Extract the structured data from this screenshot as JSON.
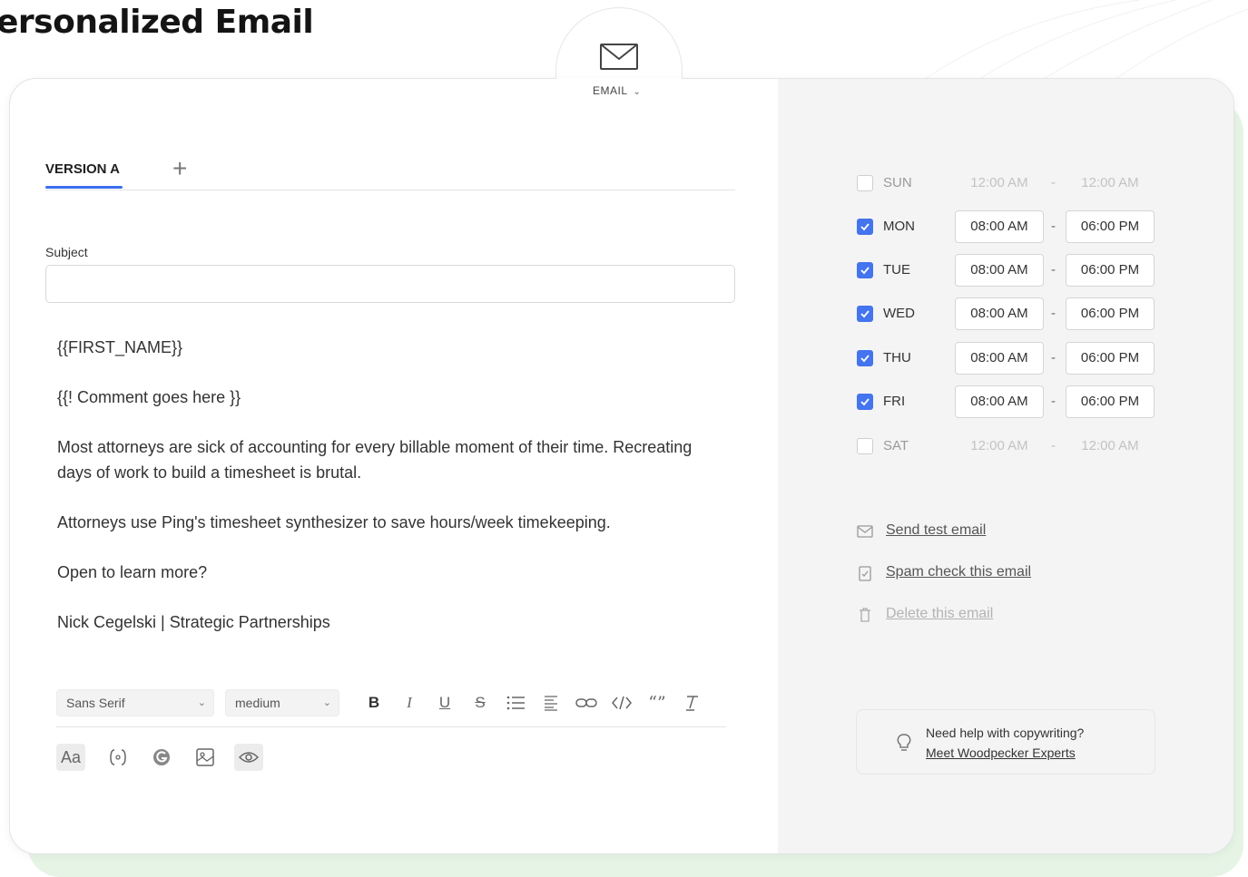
{
  "page": {
    "title": "ersonalized Email"
  },
  "channel": {
    "label": "EMAIL",
    "icon": "envelope-icon"
  },
  "tabs": [
    {
      "label": "VERSION A",
      "active": true
    }
  ],
  "subject": {
    "label": "Subject",
    "value": ""
  },
  "body_lines": [
    "{{FIRST_NAME}}",
    "{{! Comment goes here }}",
    "Most attorneys are sick of accounting for every billable moment of their time. Recreating",
    "days of work to build a timesheet is brutal.",
    "Attorneys use Ping's timesheet synthesizer to save hours/week timekeeping.",
    "Open to learn more?",
    "Nick Cegelski | Strategic Partnerships"
  ],
  "toolbar": {
    "font_family": "Sans Serif",
    "font_size": "medium",
    "bold": "B",
    "italic": "I",
    "underline": "U",
    "strike": "S",
    "font_case": "Aa"
  },
  "schedule": [
    {
      "day": "SUN",
      "enabled": false,
      "from": "12:00 AM",
      "to": "12:00 AM"
    },
    {
      "day": "MON",
      "enabled": true,
      "from": "08:00 AM",
      "to": "06:00 PM"
    },
    {
      "day": "TUE",
      "enabled": true,
      "from": "08:00 AM",
      "to": "06:00 PM"
    },
    {
      "day": "WED",
      "enabled": true,
      "from": "08:00 AM",
      "to": "06:00 PM"
    },
    {
      "day": "THU",
      "enabled": true,
      "from": "08:00 AM",
      "to": "06:00 PM"
    },
    {
      "day": "FRI",
      "enabled": true,
      "from": "08:00 AM",
      "to": "06:00 PM"
    },
    {
      "day": "SAT",
      "enabled": false,
      "from": "12:00 AM",
      "to": "12:00 AM"
    }
  ],
  "schedule_separator": "-",
  "actions": {
    "send_test": "Send test email",
    "spam_check": "Spam check this email",
    "delete": "Delete this email"
  },
  "help": {
    "text": "Need help with copywriting?",
    "link": "Meet Woodpecker Experts"
  },
  "colors": {
    "accent": "#3c6df0",
    "checkbox": "#4474ee",
    "shadow": "#e6f4e6",
    "panel": "#f4f4f4"
  }
}
